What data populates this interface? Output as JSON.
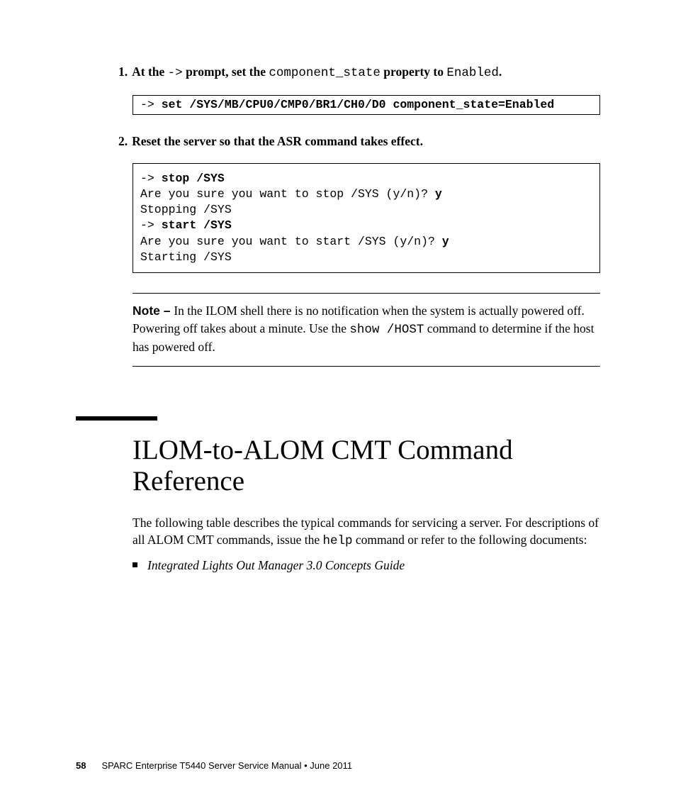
{
  "steps": {
    "s1": {
      "num": "1.",
      "a": "At the ",
      "m1": "->",
      "b": " prompt, set the ",
      "m2": "component_state",
      "c": " property to ",
      "m3": "Enabled",
      "d": "."
    },
    "code1": {
      "prompt": "-> ",
      "cmd": "set /SYS/MB/CPU0/CMP0/BR1/CH0/D0 component_state=Enabled"
    },
    "s2": {
      "num": "2.",
      "text": "Reset the server so that the ASR command takes effect."
    },
    "code2": {
      "l1p": "-> ",
      "l1c": "stop /SYS",
      "l2a": "Are you sure you want to stop /SYS (y/n)? ",
      "l2b": "y",
      "l3": "Stopping /SYS",
      "l4p": "-> ",
      "l4c": "start /SYS",
      "l5a": "Are you sure you want to start /SYS (y/n)? ",
      "l5b": "y",
      "l6": "Starting /SYS"
    }
  },
  "note": {
    "label": "Note – ",
    "a": "In the ILOM shell there is no notification when the system is actually powered off. Powering off takes about a minute. Use the ",
    "m1": "show /HOST",
    "b": " command to determine if the host has powered off."
  },
  "heading": "ILOM-to-ALOM CMT Command Reference",
  "para": {
    "a": "The following table describes the typical commands for servicing a server. For descriptions of all ALOM CMT commands, issue the ",
    "m1": "help",
    "b": " command or refer to the following documents:"
  },
  "bullet1": "Integrated Lights Out Manager 3.0 Concepts Guide",
  "footer": {
    "pagenum": "58",
    "text": "SPARC Enterprise T5440 Server Service Manual  •  June 2011"
  }
}
